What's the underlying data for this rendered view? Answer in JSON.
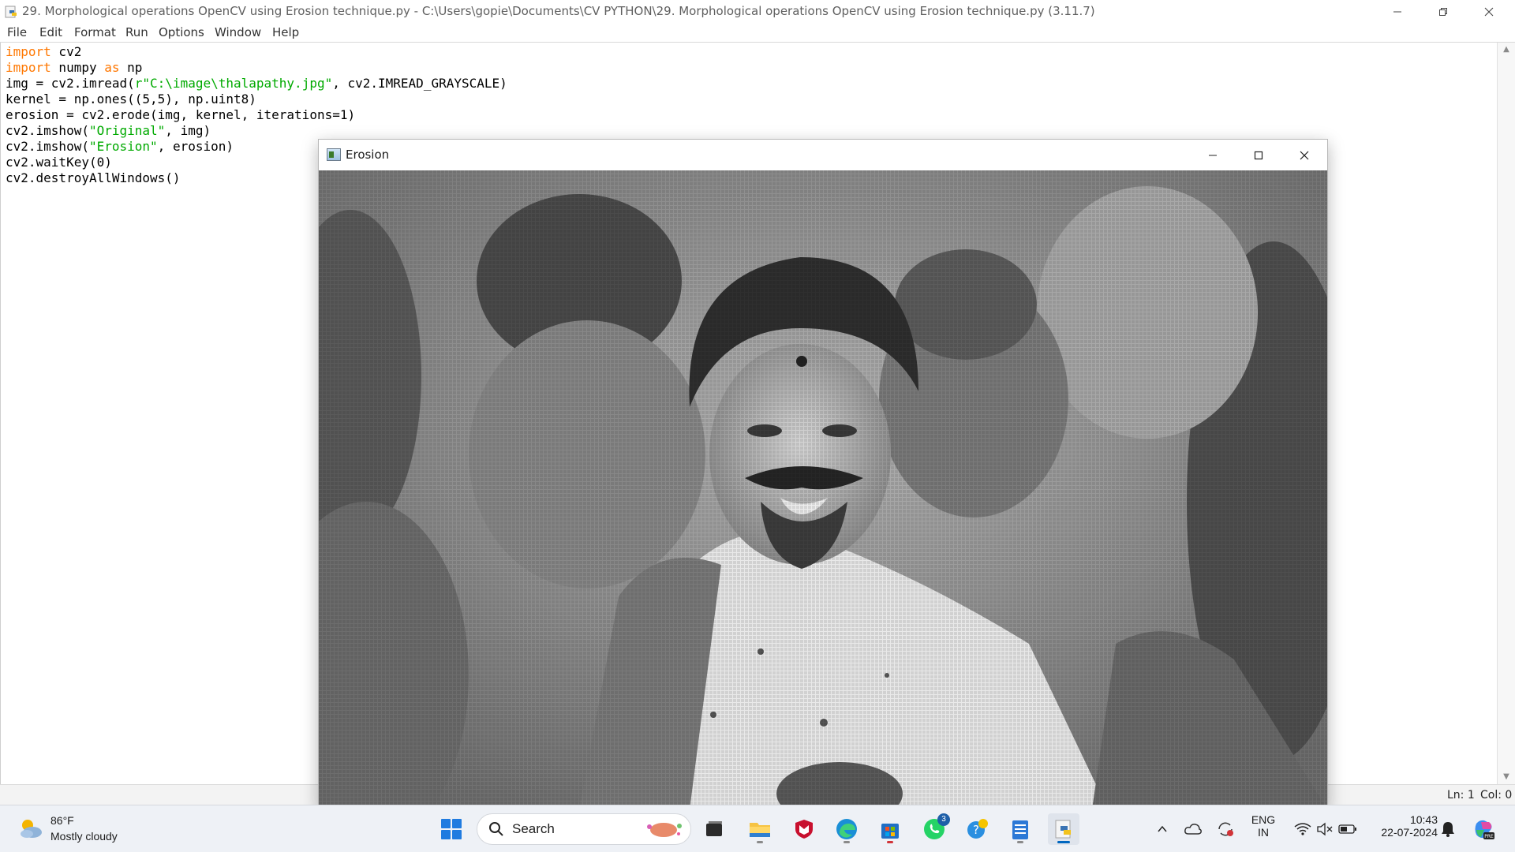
{
  "window": {
    "title": "29. Morphological operations OpenCV using Erosion technique.py - C:\\Users\\gopie\\Documents\\CV PYTHON\\29. Morphological operations OpenCV using Erosion technique.py (3.11.7)"
  },
  "menu": [
    "File",
    "Edit",
    "Format",
    "Run",
    "Options",
    "Window",
    "Help"
  ],
  "code": {
    "lines": [
      [
        {
          "t": "import",
          "c": "kw"
        },
        {
          "t": " cv2",
          "c": ""
        }
      ],
      [
        {
          "t": "import",
          "c": "kw"
        },
        {
          "t": " numpy ",
          "c": ""
        },
        {
          "t": "as",
          "c": "kw"
        },
        {
          "t": " np",
          "c": ""
        }
      ],
      [
        {
          "t": "img = cv2.imread(",
          "c": ""
        },
        {
          "t": "r\"C:\\image\\thalapathy.jpg\"",
          "c": "str"
        },
        {
          "t": ", cv2.IMREAD_GRAYSCALE)",
          "c": ""
        }
      ],
      [
        {
          "t": "kernel = np.ones((5,5), np.uint8)",
          "c": ""
        }
      ],
      [
        {
          "t": "erosion = cv2.erode(img, kernel, iterations=1)",
          "c": ""
        }
      ],
      [
        {
          "t": "cv2.imshow(",
          "c": ""
        },
        {
          "t": "\"Original\"",
          "c": "str"
        },
        {
          "t": ", img)",
          "c": ""
        }
      ],
      [
        {
          "t": "cv2.imshow(",
          "c": ""
        },
        {
          "t": "\"Erosion\"",
          "c": "str"
        },
        {
          "t": ", erosion)",
          "c": ""
        }
      ],
      [
        {
          "t": "cv2.waitKey(0)",
          "c": ""
        }
      ],
      [
        {
          "t": "cv2.destroyAllWindows()",
          "c": ""
        }
      ]
    ]
  },
  "status": {
    "line": "Ln: 1",
    "col": "Col: 0"
  },
  "erosion_window": {
    "title": "Erosion"
  },
  "taskbar": {
    "weather": {
      "temp": "86°F",
      "desc": "Mostly cloudy",
      "icon": "partly-cloudy-icon"
    },
    "search_label": "Search",
    "whatsapp_badge": "3",
    "language": {
      "line1": "ENG",
      "line2": "IN"
    },
    "clock": {
      "time": "10:43",
      "date": "22-07-2024"
    }
  },
  "colors": {
    "keyword": "#ff7700",
    "string": "#00aa00",
    "taskbar": "#eef1f6",
    "accent": "#0067c0"
  }
}
